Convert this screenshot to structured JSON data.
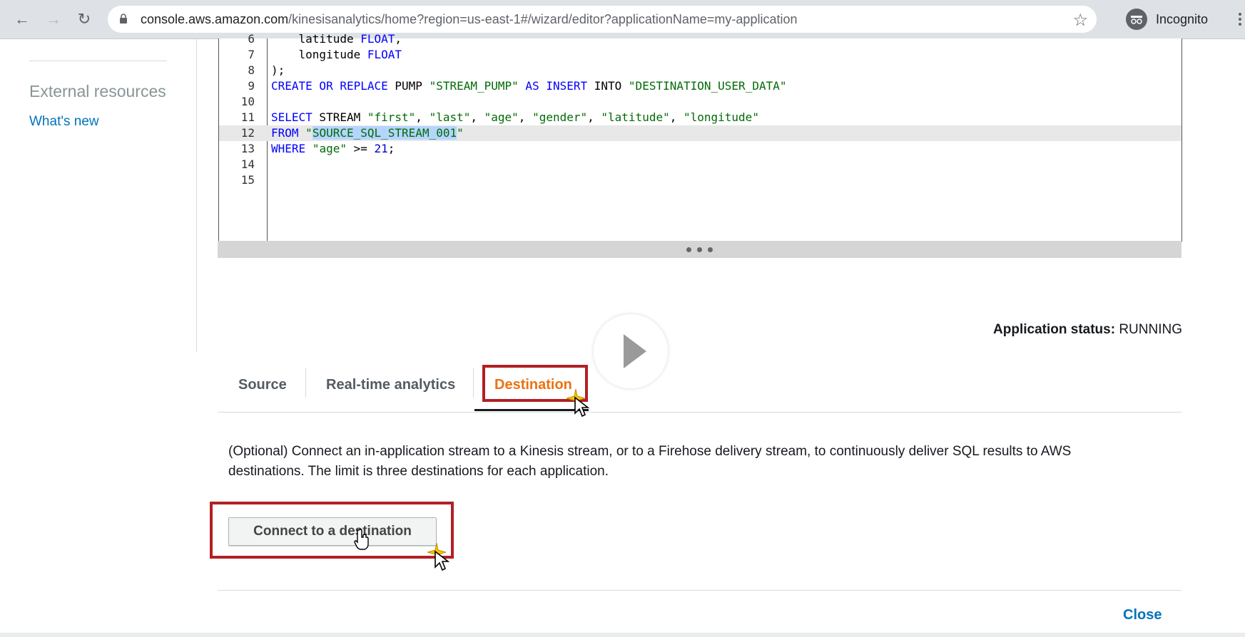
{
  "browser": {
    "url_host": "console.aws.amazon.com",
    "url_path": "/kinesisanalytics/home?region=us-east-1#/wizard/editor?applicationName=my-application",
    "incognito_label": "Incognito"
  },
  "sidebar": {
    "heading": "External resources",
    "link": "What's new"
  },
  "editor": {
    "lines": [
      {
        "n": "6",
        "tokens": [
          {
            "t": "    latitude ",
            "c": ""
          },
          {
            "t": "FLOAT",
            "c": "kw"
          },
          {
            "t": ",",
            "c": ""
          }
        ]
      },
      {
        "n": "7",
        "tokens": [
          {
            "t": "    longitude ",
            "c": ""
          },
          {
            "t": "FLOAT",
            "c": "kw"
          }
        ]
      },
      {
        "n": "8",
        "tokens": [
          {
            "t": ");",
            "c": ""
          }
        ]
      },
      {
        "n": "9",
        "tokens": [
          {
            "t": "CREATE OR REPLACE",
            "c": "kw"
          },
          {
            "t": " PUMP ",
            "c": ""
          },
          {
            "t": "\"STREAM_PUMP\"",
            "c": "str"
          },
          {
            "t": " AS INSERT",
            "c": "kw"
          },
          {
            "t": " INTO ",
            "c": ""
          },
          {
            "t": "\"DESTINATION_USER_DATA\"",
            "c": "str"
          }
        ]
      },
      {
        "n": "10",
        "tokens": []
      },
      {
        "n": "11",
        "tokens": [
          {
            "t": "SELECT",
            "c": "kw"
          },
          {
            "t": " STREAM ",
            "c": ""
          },
          {
            "t": "\"first\"",
            "c": "str"
          },
          {
            "t": ", ",
            "c": ""
          },
          {
            "t": "\"last\"",
            "c": "str"
          },
          {
            "t": ", ",
            "c": ""
          },
          {
            "t": "\"age\"",
            "c": "str"
          },
          {
            "t": ", ",
            "c": ""
          },
          {
            "t": "\"gender\"",
            "c": "str"
          },
          {
            "t": ", ",
            "c": ""
          },
          {
            "t": "\"latitude\"",
            "c": "str"
          },
          {
            "t": ", ",
            "c": ""
          },
          {
            "t": "\"longitude\"",
            "c": "str"
          }
        ]
      },
      {
        "n": "12",
        "active": true,
        "tokens": [
          {
            "t": "FROM",
            "c": "kw"
          },
          {
            "t": " ",
            "c": ""
          },
          {
            "t": "\"",
            "c": "str"
          },
          {
            "t": "SOURCE_SQL_STREAM_001",
            "c": "str sel"
          },
          {
            "t": "\"",
            "c": "str"
          }
        ]
      },
      {
        "n": "13",
        "tokens": [
          {
            "t": "WHERE",
            "c": "kw"
          },
          {
            "t": " ",
            "c": ""
          },
          {
            "t": "\"age\"",
            "c": "str"
          },
          {
            "t": " >= ",
            "c": ""
          },
          {
            "t": "21",
            "c": "num"
          },
          {
            "t": ";",
            "c": ""
          }
        ]
      },
      {
        "n": "14",
        "tokens": []
      },
      {
        "n": "15",
        "tokens": []
      }
    ]
  },
  "status": {
    "label": "Application status:",
    "value": "RUNNING"
  },
  "tabs": [
    {
      "label": "Source",
      "active": false
    },
    {
      "label": "Real-time analytics",
      "active": false
    },
    {
      "label": "Destination",
      "active": true
    }
  ],
  "destination": {
    "description": "(Optional) Connect an in-application stream to a Kinesis stream, or to a Firehose delivery stream, to continuously deliver SQL results to AWS destinations. The limit is three destinations for each application.",
    "connect_button": "Connect to a destination"
  },
  "footer": {
    "close": "Close"
  },
  "colors": {
    "accent_orange": "#ec7211",
    "link_blue": "#0073bb",
    "highlight_red": "#b21f24"
  }
}
